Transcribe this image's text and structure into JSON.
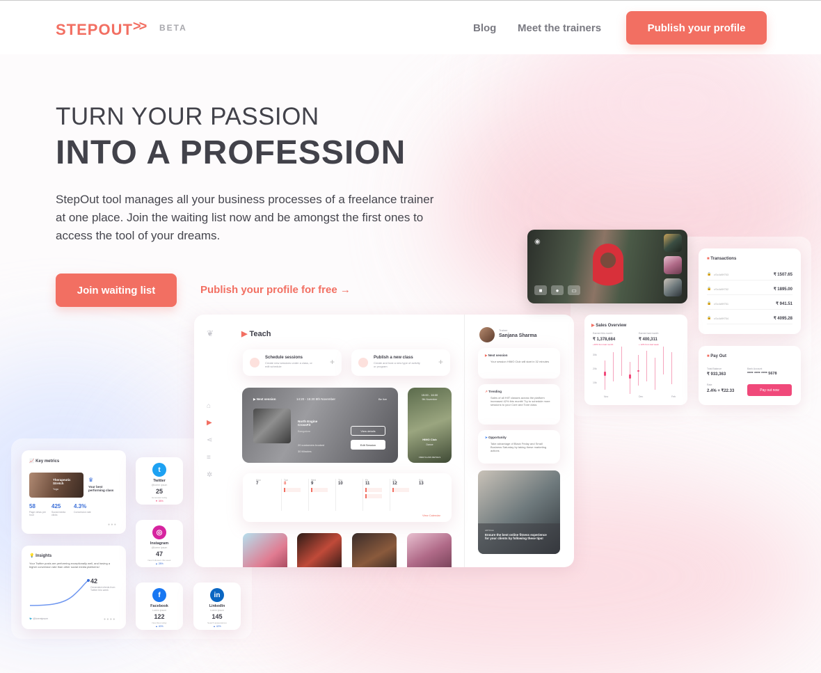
{
  "header": {
    "logo": "STEPOUT",
    "logo_arrows": ">>",
    "beta": "BETA",
    "nav": [
      "Blog",
      "Meet the trainers"
    ],
    "cta": "Publish your profile"
  },
  "hero": {
    "title_light": "TURN YOUR PASSION",
    "title_bold": "INTO A PROFESSION",
    "lead": "StepOut tool manages all your business processes of a freelance trainer at one place. Join the waiting list now and be amongst the first ones to access the tool of your dreams.",
    "join_button": "Join waiting list",
    "free_link": "Publish your profile for free →"
  },
  "mock": {
    "teach_title": "Teach",
    "schedule_title": "Schedule sessions",
    "schedule_sub": "Create new sessions under a class, or edit schedule",
    "newclass_title": "Publish a new class",
    "newclass_sub": "Create and host a new type of activity or program",
    "next_session_label": "Next session",
    "next_session_time": "14:20 - 15:20  8th November",
    "next_session_badge": "Be live",
    "class_name": "North Engine CrossFit",
    "class_place": "Bangalore",
    "class_booked": "20 customers booked",
    "class_duration": "30 Minutes",
    "view_details": "View details",
    "edit_session": "Edit Session",
    "side_card_time": "15:00 - 16:00",
    "side_card_date": "9th November",
    "side_card_name": "HIMO Club",
    "side_card_place": "Dance",
    "side_card_cta": "VIEW CLASS DETAILS",
    "calendar_days": [
      "Mon",
      "Tue",
      "Wed",
      "Thu",
      "Fri",
      "Sat",
      "Sun"
    ],
    "calendar_dates": [
      "7",
      "8",
      "9",
      "10",
      "11",
      "12",
      "13"
    ],
    "view_calendar": "View Calendar",
    "trainer_role": "Trainer",
    "trainer_name": "Sanjana Sharma",
    "feed_next_title": "Next session",
    "feed_next_body": "Your session HIMO Club will start in 32 minutes",
    "feed_trending_title": "Trending",
    "feed_trending_body": "Sales of all HIIT classes across the platform increased 42% this month! Try to schedule more sessions to your Core and Tone class",
    "feed_opp_title": "Opportunity",
    "feed_opp_body": "Take advantage of Black Friday and Small Business Saturday by taking these marketing actions",
    "article_label": "ARTICLE",
    "article_title": "Ensure the best online fitness experience for your clients by following these tips!",
    "transactions_title": "Transactions",
    "transactions": [
      {
        "id": "cSx4d9f753",
        "amount": "₹ 1507.65"
      },
      {
        "id": "cSx4d9f752",
        "amount": "₹ 1895.00"
      },
      {
        "id": "cSx4d9f751",
        "amount": "₹ 941.51"
      },
      {
        "id": "cSx4d9f754",
        "amount": "₹ 4095.28"
      }
    ],
    "sales_title": "Sales Overview",
    "sales_a_label": "Earned this month",
    "sales_a_value": "₹ 1,378,684",
    "sales_a_delta": "+16% from last month",
    "sales_b_label": "Earned last month",
    "sales_b_value": "₹ 400,311",
    "sales_b_delta": "+ 12% from last week",
    "sales_y": [
      "30k",
      "20k",
      "10k"
    ],
    "sales_x": [
      "Nov",
      "Dec",
      "Feb"
    ],
    "payout_title": "Pay Out",
    "payout_balance_label": "Total Balance",
    "payout_balance": "₹ 933,363",
    "payout_card_label": "Bank Account",
    "payout_card": "**** **** **** 5678",
    "payout_rate_label": "Rate",
    "payout_rate": "2.4% + ₹22.33",
    "payout_button": "Pay out now",
    "metrics_title": "Key metrics",
    "metrics_class_name": "Therapeutic Stretch",
    "metrics_class_type": "Yoga",
    "metrics_best": "Your best performing class",
    "metrics": [
      {
        "value": "58",
        "label": "Page views per hour"
      },
      {
        "value": "425",
        "label": "Social media clicks"
      },
      {
        "value": "4.3%",
        "label": "Conversion rate"
      }
    ],
    "insights_title": "Insights",
    "insights_body": "Your Twitter posts are performing exceptionally well, and having a higher conversion rate than other social media platforms!",
    "insights_value": "42",
    "insights_value_label": "Generated clients from Twitter this week",
    "insights_handle": "@loremipsum",
    "socials": [
      {
        "name": "Twitter",
        "handle": "@lorem ipsum",
        "value": "25",
        "label": "Generated today",
        "delta": "▼ 35%",
        "color": "#1da1f2",
        "glyph": "t"
      },
      {
        "name": "Instagram",
        "handle": "@lorem ipsum",
        "value": "47",
        "label": "New Followers this week",
        "delta": "▲ 28%",
        "color": "#d6249f",
        "glyph": "◎"
      },
      {
        "name": "Facebook",
        "handle": "Lorem ipsum",
        "value": "122",
        "label": "New likes today",
        "delta": "▲ 40%",
        "color": "#1877f2",
        "glyph": "f"
      },
      {
        "name": "LinkedIn",
        "handle": "Lorem ipsum",
        "value": "145",
        "label": "Search appearances",
        "delta": "▲ 42%",
        "color": "#0a66c2",
        "glyph": "in"
      }
    ]
  }
}
